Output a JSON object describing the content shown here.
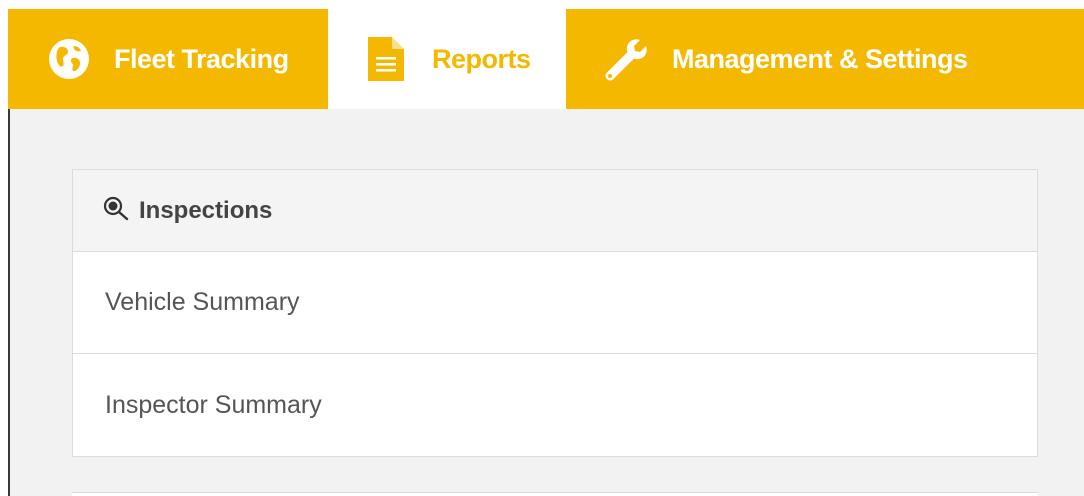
{
  "nav": {
    "tabs": [
      {
        "label": "Fleet Tracking",
        "icon": "globe-icon",
        "active": false
      },
      {
        "label": "Reports",
        "icon": "document-icon",
        "active": true
      },
      {
        "label": "Management & Settings",
        "icon": "wrench-icon",
        "active": false
      }
    ]
  },
  "panel": {
    "title": "Inspections",
    "icon": "search-icon",
    "items": [
      {
        "label": "Vehicle Summary"
      },
      {
        "label": "Inspector Summary"
      }
    ]
  },
  "colors": {
    "accent": "#f5b800",
    "background": "#f2f2f2",
    "text": "#555555"
  }
}
